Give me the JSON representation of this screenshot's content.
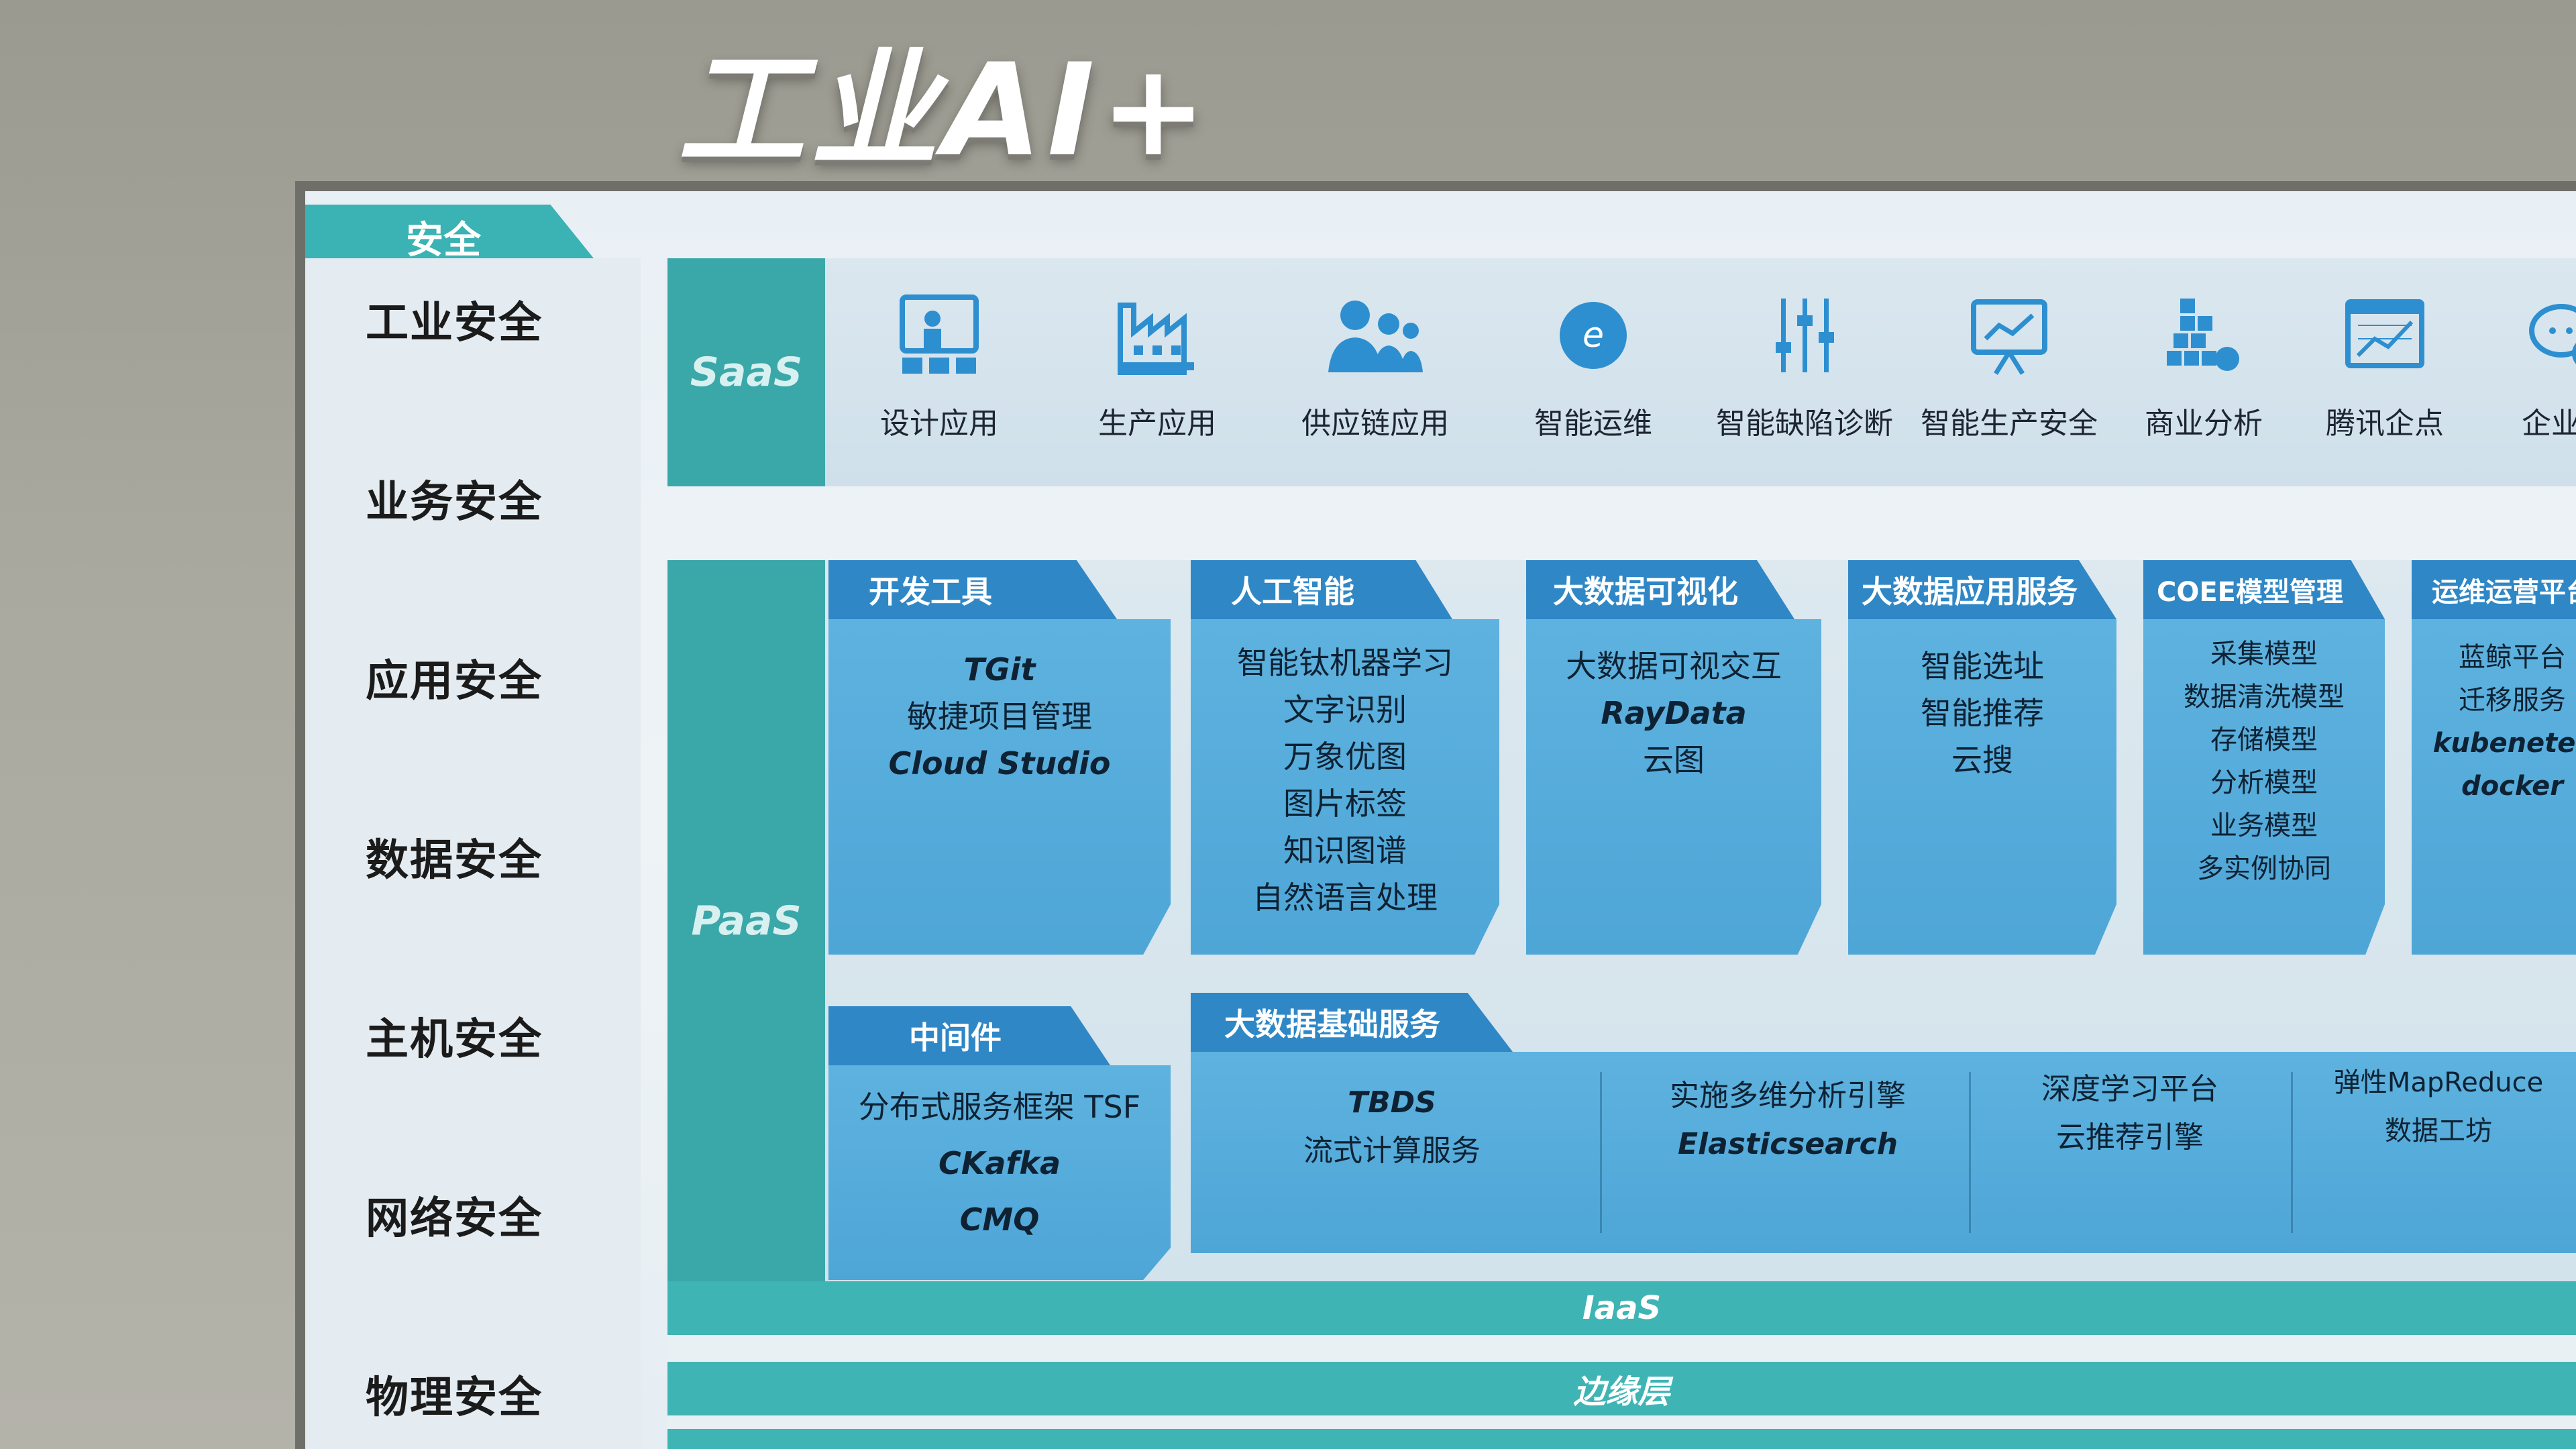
{
  "title": "工业AI+",
  "security": {
    "header": "安全",
    "items": [
      "工业安全",
      "业务安全",
      "应用安全",
      "数据安全",
      "主机安全",
      "网络安全",
      "物理安全"
    ]
  },
  "saas": {
    "label": "SaaS",
    "items": [
      {
        "label": "设计应用",
        "icon": "presentation-icon"
      },
      {
        "label": "生产应用",
        "icon": "factory-icon"
      },
      {
        "label": "供应链应用",
        "icon": "people-group-icon"
      },
      {
        "label": "智能运维",
        "icon": "e-circle-icon"
      },
      {
        "label": "智能缺陷诊断",
        "icon": "sliders-icon"
      },
      {
        "label": "智能生产安全",
        "icon": "chart-board-icon"
      },
      {
        "label": "商业分析",
        "icon": "cubes-chart-icon"
      },
      {
        "label": "腾讯企点",
        "icon": "line-chart-window-icon"
      },
      {
        "label": "企业微",
        "icon": "chat-bubbles-icon"
      }
    ]
  },
  "paas": {
    "label": "PaaS",
    "modules": [
      {
        "title": "开发工具",
        "lines": [
          "TGit",
          "敏捷项目管理",
          "Cloud Studio"
        ]
      },
      {
        "title": "人工智能",
        "lines": [
          "智能钛机器学习",
          "文字识别",
          "万象优图",
          "图片标签",
          "知识图谱",
          "自然语言处理"
        ]
      },
      {
        "title": "大数据可视化",
        "lines": [
          "大数据可视交互",
          "RayData",
          "云图"
        ]
      },
      {
        "title": "大数据应用服务",
        "lines": [
          "智能选址",
          "智能推荐",
          "云搜"
        ]
      },
      {
        "title": "COEE模型管理",
        "lines": [
          "采集模型",
          "数据清洗模型",
          "存储模型",
          "分析模型",
          "业务模型",
          "多实例协同"
        ]
      },
      {
        "title": "运维运营平台",
        "lines": [
          "蓝鲸平台",
          "迁移服务",
          "kubenetes",
          "docker"
        ]
      }
    ],
    "middleware": {
      "title": "中间件",
      "lines": [
        "分布式服务框架 TSF",
        "CKafka",
        "CMQ"
      ]
    },
    "bigdata_base": {
      "title": "大数据基础服务",
      "groups": [
        [
          "TBDS",
          "流式计算服务"
        ],
        [
          "实施多维分析引擎",
          "Elasticsearch"
        ],
        [
          "深度学习平台",
          "云推荐引擎"
        ],
        [
          "弹性MapReduce",
          "数据工坊"
        ]
      ]
    }
  },
  "iaas": {
    "label": "IaaS"
  },
  "edge": {
    "label": "边缘层"
  },
  "colors": {
    "teal": "#3bb2b3",
    "blue_tab": "#2f87c6",
    "card": "#56acdb",
    "board": "#eaf1f5"
  }
}
